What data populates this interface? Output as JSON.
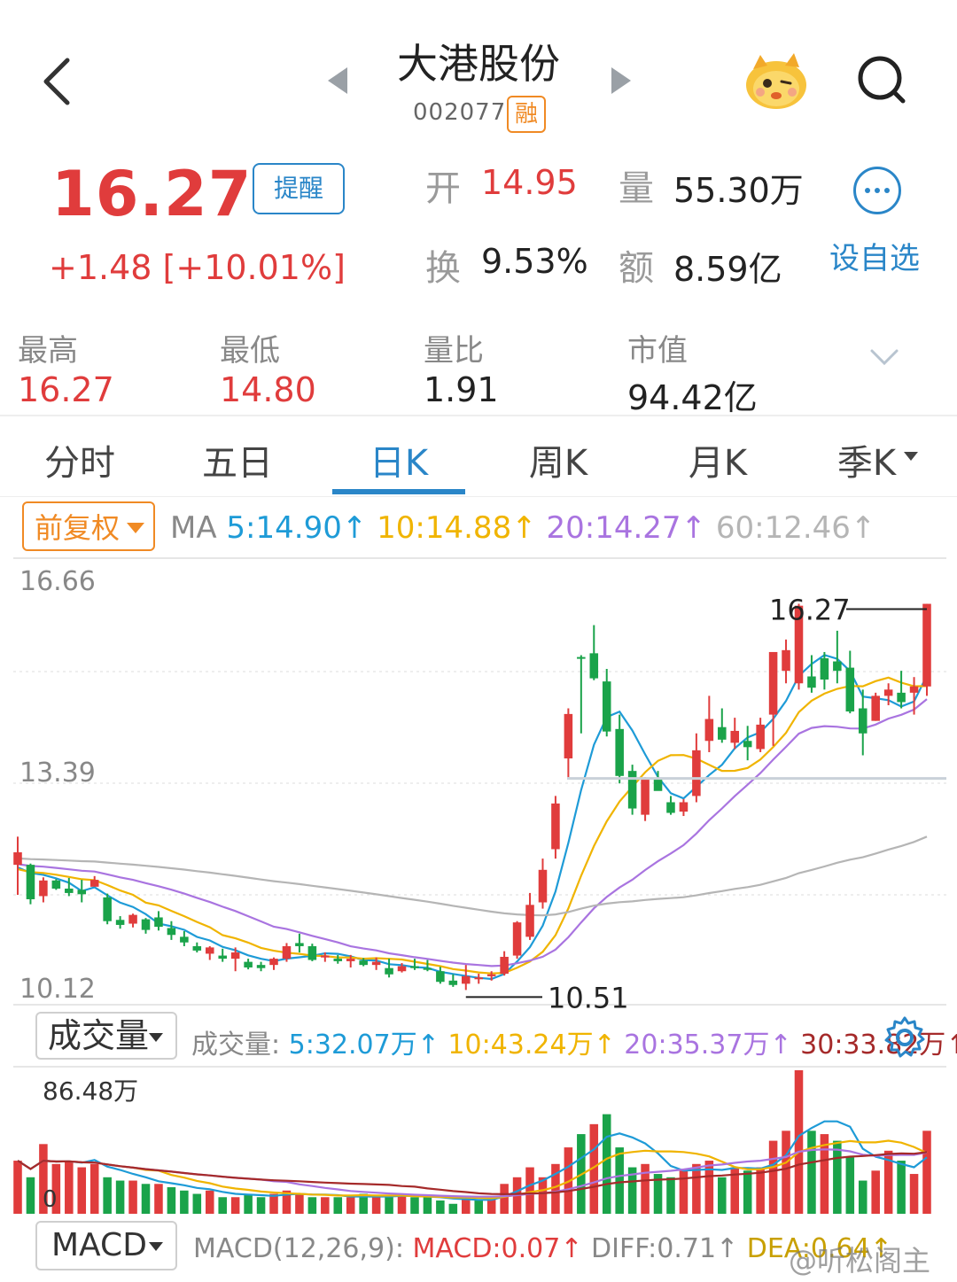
{
  "header": {
    "title": "大港股份",
    "code": "002077",
    "margin_tag": "融",
    "icons": [
      "back-arrow-icon",
      "prev-stock-icon",
      "next-stock-icon",
      "mascot-icon",
      "search-icon"
    ]
  },
  "quote": {
    "price": "16.27",
    "alert_label": "提醒",
    "change": "+1.48  [+10.01%]",
    "open_label": "开",
    "open": "14.95",
    "volume_label": "量",
    "volume": "55.30万",
    "turnover_label": "换",
    "turnover": "9.53%",
    "amount_label": "额",
    "amount": "8.59亿",
    "add_watch": "设自选"
  },
  "stats": [
    {
      "label": "最高",
      "value": "16.27",
      "color": "#e03c3c"
    },
    {
      "label": "最低",
      "value": "14.80",
      "color": "#e03c3c"
    },
    {
      "label": "量比",
      "value": "1.91",
      "color": "#222222"
    },
    {
      "label": "市值",
      "value": "94.42亿",
      "color": "#222222"
    }
  ],
  "tabs": [
    "分时",
    "五日",
    "日K",
    "周K",
    "月K",
    "季K"
  ],
  "active_tab": "日K",
  "ma_bar": {
    "adjust": "前复权",
    "prefix": "MA",
    "ma5": "5:14.90↑",
    "ma10": "10:14.88↑",
    "ma20": "20:14.27↑",
    "ma60": "60:12.46↑"
  },
  "colors": {
    "up": "#e03c3c",
    "down": "#1aa34a",
    "accent": "#2a86c8",
    "ma5": "#1e9bd7",
    "ma10": "#f0b400",
    "ma20": "#a974e0",
    "ma60": "#b5b5b5",
    "ma30": "#a52a2a",
    "orange": "#f08a24"
  },
  "chart_data": {
    "type": "candlestick",
    "y_axis_labels": [
      "16.66",
      "13.39",
      "10.12"
    ],
    "ylim": [
      10.12,
      16.66
    ],
    "annotations": {
      "high": "16.27",
      "low": "10.51"
    },
    "ohlc": [
      [
        12.1,
        12.55,
        11.62,
        12.3
      ],
      [
        12.1,
        12.12,
        11.47,
        11.55
      ],
      [
        11.6,
        11.9,
        11.5,
        11.85
      ],
      [
        11.85,
        11.87,
        11.7,
        11.72
      ],
      [
        11.72,
        11.89,
        11.6,
        11.65
      ],
      [
        11.7,
        11.86,
        11.5,
        11.63
      ],
      [
        11.75,
        11.92,
        11.82,
        11.86
      ],
      [
        11.58,
        11.64,
        11.15,
        11.2
      ],
      [
        11.22,
        11.28,
        11.08,
        11.14
      ],
      [
        11.16,
        11.32,
        11.1,
        11.3
      ],
      [
        11.23,
        11.25,
        11.0,
        11.06
      ],
      [
        11.26,
        11.36,
        11.05,
        11.11
      ],
      [
        11.09,
        11.2,
        10.9,
        10.98
      ],
      [
        10.95,
        11.04,
        10.8,
        10.86
      ],
      [
        10.8,
        10.86,
        10.7,
        10.73
      ],
      [
        10.68,
        10.8,
        10.58,
        10.78
      ],
      [
        10.65,
        10.76,
        10.55,
        10.6
      ],
      [
        10.6,
        10.78,
        10.4,
        10.7
      ],
      [
        10.55,
        10.6,
        10.43,
        10.46
      ],
      [
        10.5,
        10.55,
        10.4,
        10.45
      ],
      [
        10.5,
        10.62,
        10.42,
        10.6
      ],
      [
        10.6,
        10.85,
        10.55,
        10.8
      ],
      [
        10.85,
        11.0,
        10.7,
        10.8
      ],
      [
        10.8,
        10.84,
        10.56,
        10.58
      ],
      [
        10.62,
        10.7,
        10.55,
        10.65
      ],
      [
        10.6,
        10.66,
        10.52,
        10.56
      ],
      [
        10.56,
        10.66,
        10.46,
        10.6
      ],
      [
        10.57,
        10.61,
        10.48,
        10.5
      ],
      [
        10.5,
        10.62,
        10.42,
        10.55
      ],
      [
        10.45,
        10.6,
        10.3,
        10.35
      ],
      [
        10.4,
        10.53,
        10.38,
        10.48
      ],
      [
        10.48,
        10.6,
        10.42,
        10.45
      ],
      [
        10.45,
        10.58,
        10.4,
        10.44
      ],
      [
        10.4,
        10.47,
        10.2,
        10.23
      ],
      [
        10.25,
        10.35,
        10.15,
        10.18
      ],
      [
        10.2,
        10.5,
        10.1,
        10.32
      ],
      [
        10.28,
        10.36,
        10.2,
        10.3
      ],
      [
        10.32,
        10.4,
        10.25,
        10.35
      ],
      [
        10.36,
        10.72,
        10.33,
        10.63
      ],
      [
        10.65,
        11.2,
        10.6,
        11.18
      ],
      [
        10.95,
        11.65,
        10.9,
        11.46
      ],
      [
        11.5,
        12.2,
        11.4,
        12.02
      ],
      [
        12.35,
        13.2,
        12.2,
        13.08
      ],
      [
        13.8,
        14.6,
        13.5,
        14.51
      ],
      [
        15.42,
        15.45,
        14.2,
        15.4
      ],
      [
        15.48,
        15.93,
        15.05,
        15.08
      ],
      [
        15.03,
        15.23,
        14.15,
        14.23
      ],
      [
        14.27,
        14.5,
        13.4,
        13.52
      ],
      [
        13.6,
        13.7,
        12.9,
        13.0
      ],
      [
        12.9,
        13.5,
        12.8,
        13.49
      ],
      [
        13.47,
        13.6,
        13.3,
        13.28
      ],
      [
        13.1,
        13.2,
        12.9,
        12.93
      ],
      [
        12.95,
        13.15,
        12.88,
        13.1
      ],
      [
        13.2,
        14.2,
        13.1,
        13.93
      ],
      [
        14.08,
        14.8,
        13.9,
        14.43
      ],
      [
        14.3,
        14.6,
        14.05,
        14.1
      ],
      [
        14.05,
        14.45,
        13.95,
        14.24
      ],
      [
        14.08,
        14.32,
        13.77,
        13.98
      ],
      [
        13.95,
        14.45,
        13.9,
        14.34
      ],
      [
        14.5,
        15.3,
        14.0,
        15.5
      ],
      [
        15.2,
        15.7,
        15.0,
        15.53
      ],
      [
        15.0,
        16.27,
        14.9,
        16.24
      ],
      [
        15.11,
        15.45,
        14.85,
        14.93
      ],
      [
        15.4,
        15.5,
        14.9,
        15.06
      ],
      [
        15.35,
        15.84,
        15.0,
        15.2
      ],
      [
        15.25,
        15.52,
        14.52,
        14.55
      ],
      [
        14.6,
        14.9,
        13.85,
        14.2
      ],
      [
        14.4,
        14.85,
        14.4,
        14.8
      ],
      [
        14.8,
        15.0,
        14.65,
        14.9
      ],
      [
        14.85,
        15.2,
        14.6,
        14.7
      ],
      [
        14.85,
        15.1,
        14.5,
        14.95
      ],
      [
        14.95,
        16.27,
        14.8,
        16.27
      ]
    ],
    "ma_series": [
      "MA5",
      "MA10",
      "MA20",
      "MA60"
    ]
  },
  "volume_bar": {
    "button": "成交量",
    "label": "成交量:",
    "ma5": "5:32.07万↑",
    "ma10": "10:43.24万↑",
    "ma20": "20:35.37万↑",
    "ma30": "30:33.82万↑",
    "max_label": "86.48万",
    "zero_label": "0"
  },
  "volume_chart": {
    "type": "bar",
    "max": 86.48,
    "values": [
      32,
      22,
      42,
      30,
      32,
      28,
      30,
      22,
      20,
      20,
      18,
      18,
      16,
      14,
      12,
      14,
      10,
      10,
      12,
      10,
      12,
      14,
      12,
      10,
      10,
      10,
      10,
      12,
      10,
      10,
      12,
      10,
      10,
      8,
      6,
      10,
      8,
      10,
      18,
      22,
      28,
      22,
      30,
      40,
      48,
      54,
      60,
      40,
      28,
      30,
      24,
      22,
      26,
      30,
      32,
      22,
      28,
      26,
      28,
      44,
      50,
      86.48,
      50,
      48,
      44,
      34,
      20,
      26,
      38,
      32,
      24,
      50
    ],
    "up": [
      true,
      false,
      true,
      true,
      true,
      true,
      true,
      false,
      false,
      true,
      false,
      true,
      false,
      false,
      false,
      true,
      false,
      true,
      false,
      false,
      true,
      true,
      true,
      false,
      true,
      false,
      true,
      false,
      true,
      false,
      true,
      false,
      false,
      false,
      false,
      true,
      false,
      true,
      true,
      true,
      true,
      true,
      true,
      true,
      false,
      true,
      false,
      false,
      false,
      true,
      false,
      false,
      true,
      true,
      true,
      false,
      true,
      false,
      true,
      true,
      true,
      true,
      false,
      true,
      false,
      false,
      false,
      true,
      true,
      false,
      true,
      true
    ]
  },
  "macd_bar": {
    "button": "MACD",
    "params": "MACD(12,26,9):",
    "macd": "MACD:0.07↑",
    "diff": "DIFF:0.71↑",
    "dea": "DEA:0.64↑"
  },
  "watermark": "@听松阁主"
}
